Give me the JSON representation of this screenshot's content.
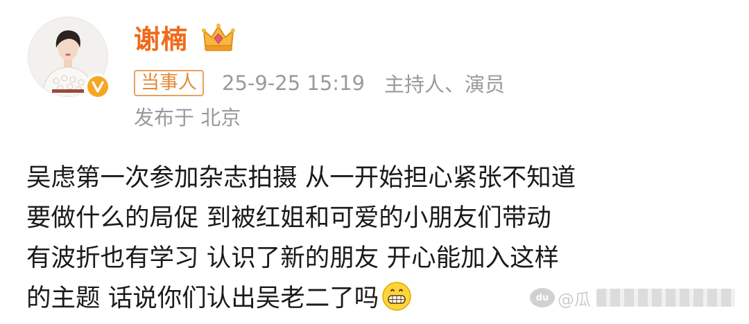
{
  "post": {
    "author_name": "谢楠",
    "author_badge_icon": "crown-icon",
    "verified_icon": "verified-v-icon",
    "tag": "当事人",
    "timestamp": "25-9-25 15:19",
    "role": "主持人、演员",
    "location": "发布于 北京",
    "content_lines": [
      "吴虑第一次参加杂志拍摄 从一开始担心紧张不知道",
      "要做什么的局促 到被红姐和可爱的小朋友们带动",
      "有波折也有学习 认识了新的朋友 开心能加入这样",
      "的主题 话说你们认出吴老二了吗"
    ],
    "content_emoji": "grinning-face-icon"
  },
  "watermark": {
    "text": "@瓜",
    "icon": "baidu-paw-icon"
  },
  "colors": {
    "name": "#ef6a1a",
    "badge": "#e38a3a",
    "meta": "#9a9a9a",
    "text": "#1a1a1a"
  }
}
